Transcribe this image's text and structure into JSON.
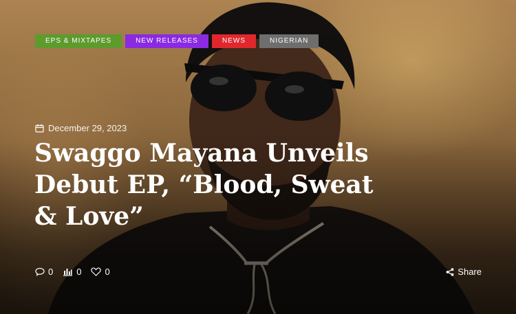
{
  "hero": {
    "categories": [
      {
        "label": "EPS & MIXTAPES",
        "color": "#5d9b2d"
      },
      {
        "label": "NEW RELEASES",
        "color": "#8a2be2"
      },
      {
        "label": "NEWS",
        "color": "#e0282c"
      },
      {
        "label": "NIGERIAN",
        "color": "#6e6e6e"
      }
    ],
    "date": "December 29, 2023",
    "title": "Swaggo Mayana Unveils Debut EP, “Blood, Sweat & Love”",
    "stats": {
      "comments": "0",
      "views": "0",
      "likes": "0"
    },
    "share_label": "Share"
  }
}
